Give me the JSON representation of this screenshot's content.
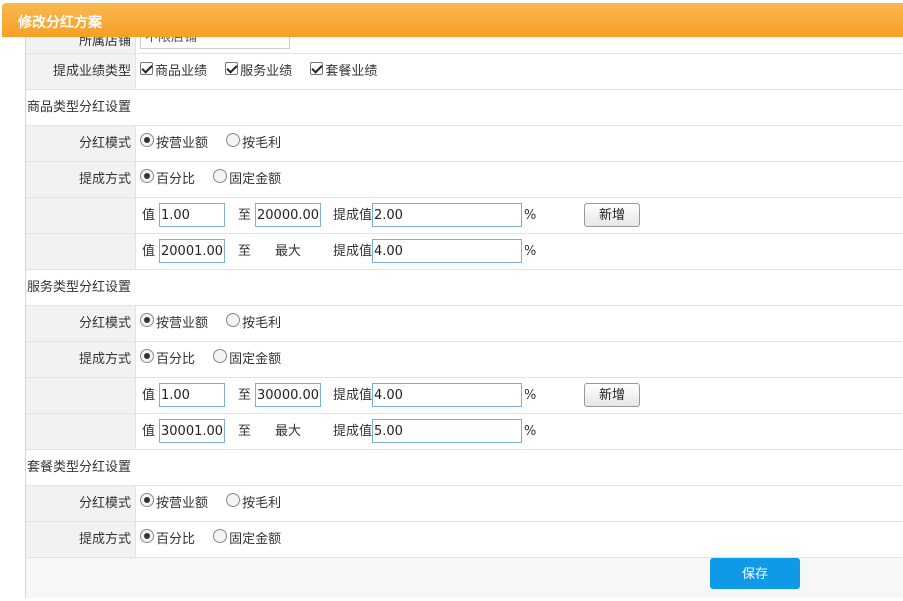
{
  "dialog": {
    "title": "修改分红方案"
  },
  "store": {
    "label": "所属店铺",
    "value": "不限店铺"
  },
  "perf_type": {
    "label": "提成业绩类型",
    "options": [
      "商品业绩",
      "服务业绩",
      "套餐业绩"
    ]
  },
  "labels": {
    "mode": "分红模式",
    "method": "提成方式",
    "value": "值",
    "to": "至",
    "max": "最大",
    "commission": "提成值",
    "percent": "%"
  },
  "mode_options": [
    "按营业额",
    "按毛利"
  ],
  "method_options": [
    "百分比",
    "固定金额"
  ],
  "goods": {
    "title": "商品类型分红设置",
    "tiers": [
      {
        "from": "1.00",
        "to": "20000.00",
        "value": "2.00"
      },
      {
        "from": "20001.00",
        "value": "4.00"
      }
    ]
  },
  "service": {
    "title": "服务类型分红设置",
    "tiers": [
      {
        "from": "1.00",
        "to": "30000.00",
        "value": "4.00"
      },
      {
        "from": "30001.00",
        "value": "5.00"
      }
    ]
  },
  "package": {
    "title": "套餐类型分红设置"
  },
  "buttons": {
    "add": "新增",
    "save": "保存"
  },
  "colors": {
    "title_bar": "#f7a530",
    "save_button": "#0f9ae8"
  }
}
